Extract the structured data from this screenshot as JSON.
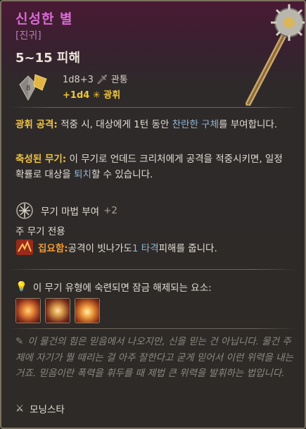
{
  "item": {
    "name": "신성한 별",
    "rarity": "[진귀]",
    "damage": "5~15 피해",
    "dice_value": "8",
    "stat_line1": "1d8+3",
    "stat_line1_type": "관통",
    "stat_line2": "+1d4",
    "stat_line2_type": "광휘"
  },
  "abilities": {
    "radiant_strike_name": "광휘 공격:",
    "radiant_strike_text_a": " 적중 시, 대상에게 1턴 동안 ",
    "radiant_strike_link": "찬란한 구체",
    "radiant_strike_text_b": "를 부여합니다.",
    "smite_name": "축성된 무기:",
    "smite_text_a": " 이 무기로 언데드 크리처에게 공격을 적중시키면, 일정 확률로 대상을 ",
    "smite_link": "퇴치",
    "smite_text_b": "할 수 있습니다."
  },
  "enchant": {
    "label": "무기 마법 부여",
    "value": "+2"
  },
  "mainhand": "주 무기 전용",
  "focus": {
    "name": "집요함:",
    "text_a": " 공격이 빗나가도 ",
    "value": "1 타격",
    "text_b": " 피해를 줍니다."
  },
  "unlock": {
    "label": "이 무기 유형에 숙련되면 잠금 해제되는 요소:",
    "skills": [
      "skill-1",
      "skill-2",
      "skill-3"
    ]
  },
  "lore": "이 물건의 힘은 믿음에서 나오지만, 신을 믿는 건 아닙니다. 물건 주제에 자기가 뭘 때리는 걸 아주 잘한다고 굳게 믿어서 이런 위력을 내는 거죠. 믿음이란 폭력을 휘두를 때 제법 큰 위력을 발휘하는 법입니다.",
  "source": "모닝스타",
  "colors": {
    "title": "#d86ad6",
    "highlight": "#f1c445",
    "link": "#8fb6d4",
    "focus": "#f09a2f"
  }
}
